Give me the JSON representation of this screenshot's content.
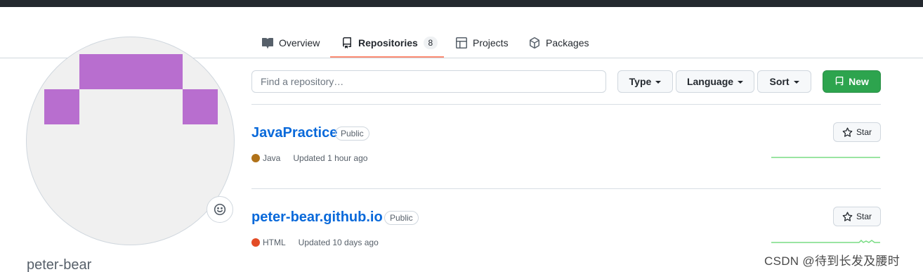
{
  "tabs": [
    {
      "label": "Overview",
      "icon": "book-icon"
    },
    {
      "label": "Repositories",
      "icon": "repo-icon",
      "count": "8"
    },
    {
      "label": "Projects",
      "icon": "table-icon"
    },
    {
      "label": "Packages",
      "icon": "package-icon"
    }
  ],
  "profile": {
    "username": "peter-bear",
    "avatar_color": "#b86ecf",
    "status_icon": "smiley-icon"
  },
  "filters": {
    "search_placeholder": "Find a repository…",
    "type_label": "Type",
    "language_label": "Language",
    "sort_label": "Sort",
    "new_label": "New"
  },
  "repos": [
    {
      "name": "JavaPractice",
      "visibility": "Public",
      "language": "Java",
      "language_color": "#b07219",
      "updated": "Updated 1 hour ago",
      "star_label": "Star"
    },
    {
      "name": "peter-bear.github.io",
      "visibility": "Public",
      "language": "HTML",
      "language_color": "#e34c26",
      "updated": "Updated 10 days ago",
      "star_label": "Star"
    }
  ],
  "colors": {
    "accent_green": "#2da44e",
    "link_blue": "#0969da",
    "tab_underline": "#fd8c73",
    "sparkline": "#56d364"
  },
  "watermark": "CSDN @待到长发及腰时"
}
